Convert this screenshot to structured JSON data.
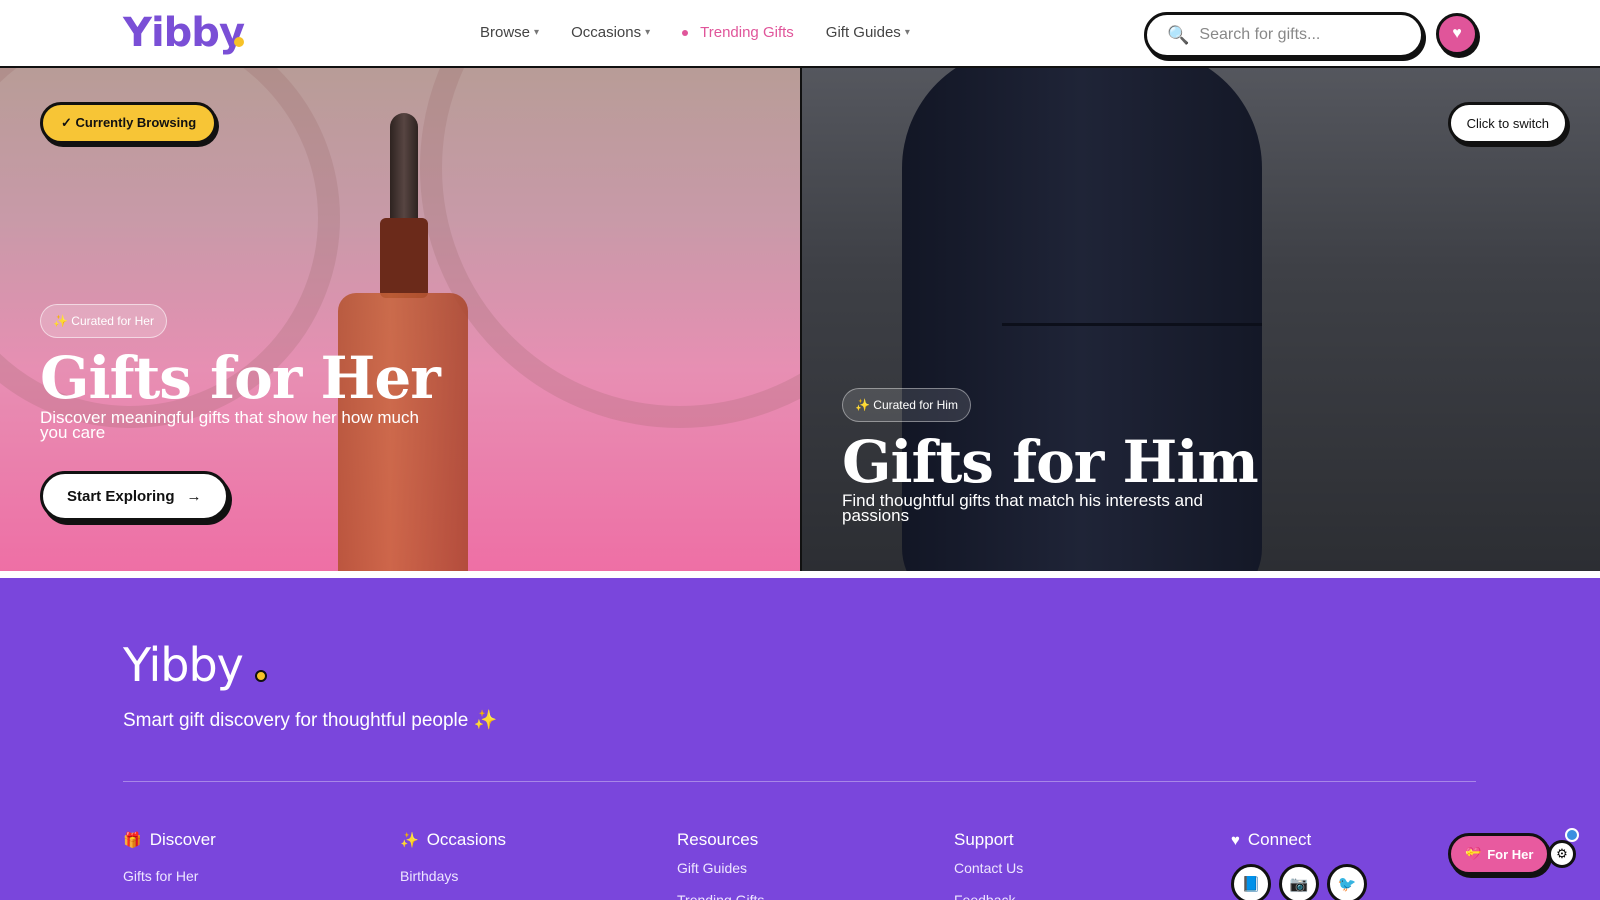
{
  "header": {
    "logo": "Yibby",
    "nav": [
      {
        "label": "Browse",
        "chevron": "▾"
      },
      {
        "label": "Occasions",
        "chevron": "▾"
      },
      {
        "label": "Trending Gifts"
      },
      {
        "label": "Gift Guides",
        "chevron": "▾"
      }
    ],
    "search_placeholder": "Search for gifts...",
    "search_icon": "🔍",
    "heart_icon": "♥"
  },
  "hero": {
    "her": {
      "badge": "✓ Currently Browsing",
      "chip": "✨ Curated for Her",
      "title": "Gifts for Her",
      "subtitle": "Discover meaningful gifts that show her how much you care",
      "cta": "Start Exploring",
      "cta_arrow": "→"
    },
    "him": {
      "switch": "Click to switch",
      "chip": "✨ Curated for Him",
      "title": "Gifts for Him",
      "subtitle": "Find thoughtful gifts that match his interests and passions"
    }
  },
  "footer": {
    "logo": "Yibby",
    "tagline": "Smart gift discovery for thoughtful people ✨",
    "columns": [
      {
        "icon": "🎁",
        "title": "Discover",
        "links": [
          "Gifts for Her"
        ]
      },
      {
        "icon": "✨",
        "title": "Occasions",
        "links": [
          "Birthdays"
        ]
      },
      {
        "icon": "",
        "title": "Resources",
        "links": [
          "Gift Guides",
          "Trending Gifts"
        ]
      },
      {
        "icon": "",
        "title": "Support",
        "links": [
          "Contact Us",
          "Feedback"
        ]
      },
      {
        "icon": "♥",
        "title": "Connect",
        "social": [
          "📘",
          "📷",
          "🐦"
        ]
      }
    ]
  },
  "floating": {
    "for_her_icon": "💝",
    "for_her_label": "For Her",
    "gear_icon": "⚙"
  },
  "colors": {
    "brand_purple": "#7a46dc",
    "brand_pink": "#e0559a",
    "accent_yellow": "#f7c536"
  }
}
